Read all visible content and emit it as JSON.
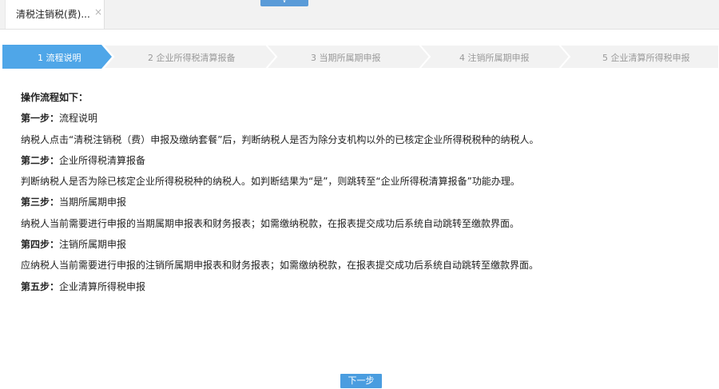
{
  "tab": {
    "title": "清税注销税(费)...",
    "close": "×"
  },
  "collapse_handle": "∨",
  "steps": [
    {
      "label": "1  流程说明",
      "active": true
    },
    {
      "label": "2  企业所得税清算报备",
      "active": false
    },
    {
      "label": "3  当期所属期申报",
      "active": false
    },
    {
      "label": "4  注销所属期申报",
      "active": false
    },
    {
      "label": "5  企业清算所得税申报",
      "active": false
    }
  ],
  "colors": {
    "active_step": "#4fa6e8",
    "inactive_step": "#f2f2f2",
    "inactive_text": "#999999",
    "button": "#4a9de0"
  },
  "content": {
    "heading": "操作流程如下：",
    "step1_title": "第一步：",
    "step1_name": "流程说明",
    "step1_desc": "纳税人点击“清税注销税（费）申报及缴纳套餐”后，判断纳税人是否为除分支机构以外的已核定企业所得税税种的纳税人。",
    "step2_title": "第二步：",
    "step2_name": "企业所得税清算报备",
    "step2_desc": "判断纳税人是否为除已核定企业所得税税种的纳税人。如判断结果为“是”，则跳转至“企业所得税清算报备”功能办理。",
    "step3_title": "第三步：",
    "step3_name": "当期所属期申报",
    "step3_desc": "纳税人当前需要进行申报的当期属期申报表和财务报表；如需缴纳税款，在报表提交成功后系统自动跳转至缴款界面。",
    "step4_title": "第四步：",
    "step4_name": "注销所属期申报",
    "step4_desc": "应纳税人当前需要进行申报的注销所属期申报表和财务报表；如需缴纳税款，在报表提交成功后系统自动跳转至缴款界面。",
    "step5_title": "第五步：",
    "step5_name": "企业清算所得税申报"
  },
  "next_button": "下一步"
}
